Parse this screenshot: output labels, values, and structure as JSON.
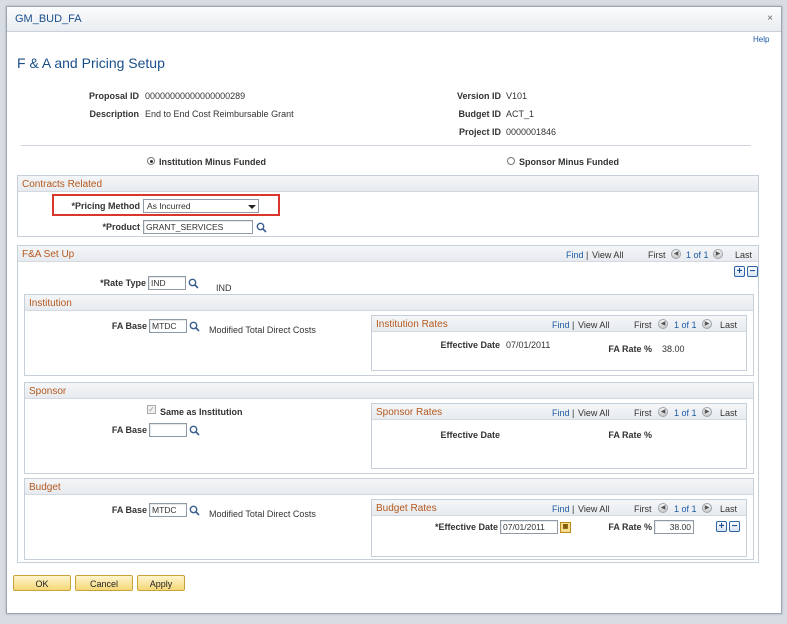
{
  "window": {
    "title": "GM_BUD_FA",
    "close": "×"
  },
  "help_label": "Help",
  "page_title": "F & A and Pricing Setup",
  "header": {
    "proposal_id_label": "Proposal ID",
    "proposal_id": "00000000000000000289",
    "description_label": "Description",
    "description": "End to End Cost Reimbursable Grant",
    "version_id_label": "Version ID",
    "version_id": "V101",
    "budget_id_label": "Budget ID",
    "budget_id": "ACT_1",
    "project_id_label": "Project ID",
    "project_id": "0000001846"
  },
  "radios": {
    "institution_minus_funded": "Institution Minus Funded",
    "sponsor_minus_funded": "Sponsor Minus Funded",
    "selected": "institution_minus_funded"
  },
  "contracts": {
    "title": "Contracts Related",
    "pricing_method_label": "*Pricing Method",
    "pricing_method_value": "As Incurred",
    "product_label": "*Product",
    "product_value": "GRANT_SERVICES"
  },
  "fa_setup": {
    "title": "F&A Set Up",
    "nav": {
      "find": "Find",
      "sep": "|",
      "view_all": "View All",
      "first": "First",
      "count": "1 of 1",
      "last": "Last"
    },
    "rate_type_label": "*Rate Type",
    "rate_type_value": "IND",
    "rate_type_desc": "IND",
    "add": "+",
    "remove": "−"
  },
  "institution": {
    "title": "Institution",
    "fa_base_label": "FA Base",
    "fa_base_value": "MTDC",
    "fa_base_desc": "Modified Total Direct Costs",
    "rates": {
      "title": "Institution Rates",
      "nav": {
        "find": "Find",
        "sep": "|",
        "view_all": "View All",
        "first": "First",
        "count": "1 of 1",
        "last": "Last"
      },
      "effective_date_label": "Effective Date",
      "effective_date_value": "07/01/2011",
      "fa_rate_label": "FA Rate %",
      "fa_rate_value": "38.00"
    }
  },
  "sponsor": {
    "title": "Sponsor",
    "same_as_label": "Same as Institution",
    "check_mark": "✓",
    "fa_base_label": "FA Base",
    "fa_base_value": "",
    "rates": {
      "title": "Sponsor Rates",
      "nav": {
        "find": "Find",
        "sep": "|",
        "view_all": "View All",
        "first": "First",
        "count": "1 of 1",
        "last": "Last"
      },
      "effective_date_label": "Effective Date",
      "fa_rate_label": "FA Rate %"
    }
  },
  "budget": {
    "title": "Budget",
    "fa_base_label": "FA Base",
    "fa_base_value": "MTDC",
    "fa_base_desc": "Modified Total Direct Costs",
    "rates": {
      "title": "Budget Rates",
      "nav": {
        "find": "Find",
        "sep": "|",
        "view_all": "View All",
        "first": "First",
        "count": "1 of 1",
        "last": "Last"
      },
      "effective_date_label": "*Effective Date",
      "effective_date_value": "07/01/2011",
      "fa_rate_label": "FA Rate %",
      "fa_rate_value": "38.00",
      "add": "+",
      "remove": "−"
    }
  },
  "footer": {
    "ok": "OK",
    "cancel": "Cancel",
    "apply": "Apply"
  },
  "colors": {
    "accent": "#1b4f8a",
    "section_title": "#b5581e",
    "highlight": "#d9372c"
  }
}
